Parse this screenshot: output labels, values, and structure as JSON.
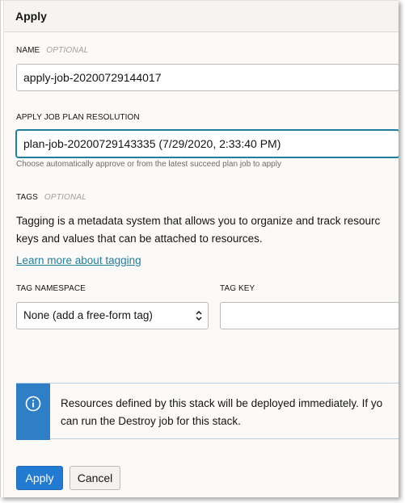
{
  "dialog": {
    "title": "Apply",
    "name_label": "NAME",
    "optional": "OPTIONAL",
    "name_value": "apply-job-20200729144017",
    "plan_label": "APPLY JOB PLAN RESOLUTION",
    "plan_value": "plan-job-20200729143335 (7/29/2020, 2:33:40 PM)",
    "plan_helper": "Choose automatically approve or from the latest succeed plan job to apply",
    "tags_label": "TAGS",
    "tags_desc_line1": "Tagging is a metadata system that allows you to organize and track resourc",
    "tags_desc_line2": "keys and values that can be attached to resources.",
    "learn_more": "Learn more about tagging",
    "tag_namespace_label": "TAG NAMESPACE",
    "tag_namespace_value": "None (add a free-form tag)",
    "tag_key_label": "TAG KEY",
    "tag_key_value": "",
    "notice_line1": "Resources defined by this stack will be deployed immediately. If yo",
    "notice_line2": "can run the Destroy job for this stack.",
    "apply_button": "Apply",
    "cancel_button": "Cancel"
  },
  "colors": {
    "primary": "#227bd0",
    "link": "#227e9e",
    "info": "#2f7fc6"
  },
  "icons": {
    "notice": "info-circle-icon",
    "select": "chevron-up-down-icon"
  }
}
